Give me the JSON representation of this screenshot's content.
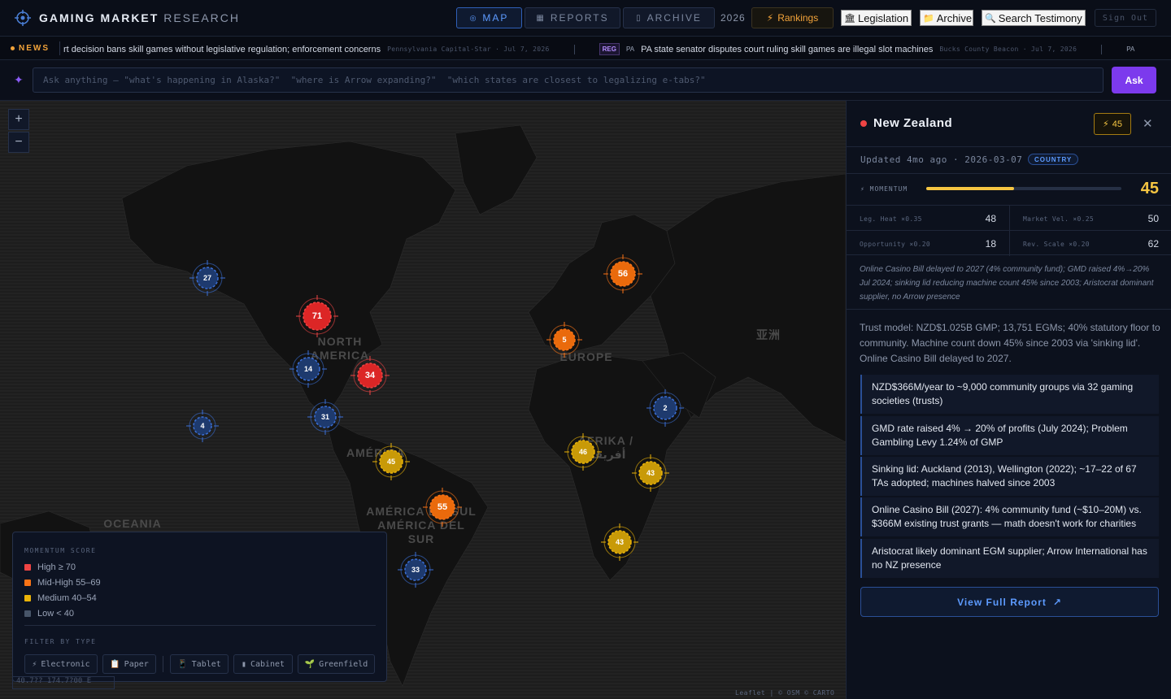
{
  "header": {
    "brand_main": "GAMING MARKET",
    "brand_sub": "RESEARCH",
    "nav": [
      {
        "icon": "◎",
        "label": "MAP"
      },
      {
        "icon": "▦",
        "label": "REPORTS"
      },
      {
        "icon": "▯",
        "label": "ARCHIVE"
      }
    ],
    "year": "2026",
    "rankings_icon": "⚡",
    "rankings_label": "Rankings",
    "legislation_icon": "🏛",
    "legislation_label": "Legislation",
    "archive_icon": "📁",
    "archive_label": "Archive",
    "testimony_icon": "🔍",
    "testimony_label": "Search Testimony",
    "signout_label": "Sign Out"
  },
  "ticker": {
    "label": "NEWS",
    "items": [
      {
        "tag": "",
        "state": "",
        "headline": "rt decision bans skill games without legislative regulation; enforcement concerns",
        "source": "Pennsylvania Capital-Star · Jul 7, 2026"
      },
      {
        "tag": "REG",
        "state": "PA",
        "headline": "PA state senator disputes court ruling skill games are illegal slot machines",
        "source": "Bucks County Beacon · Jul 7, 2026"
      },
      {
        "tag": "",
        "state": "",
        "headline": "PA",
        "source": ""
      }
    ]
  },
  "ask": {
    "icon": "✦",
    "placeholder": "Ask anything — \"what's happening in Alaska?\"  \"where is Arrow expanding?\"  \"which states are closest to legalizing e-tabs?\"",
    "button": "Ask"
  },
  "map": {
    "zoom_in": "+",
    "zoom_out": "−",
    "regions": [
      "NORTH AMERICA",
      "EUROPE",
      "AFRIKA / أفريقيا",
      "AMÉRICA DO SUL AMÉRICA DEL SUR",
      "AMÉRICA",
      "OCEANIA",
      "亚洲"
    ],
    "markers": [
      {
        "value": "27",
        "level": "low"
      },
      {
        "value": "71",
        "level": "high"
      },
      {
        "value": "14",
        "level": "low"
      },
      {
        "value": "34",
        "level": "high"
      },
      {
        "value": "31",
        "level": "low"
      },
      {
        "value": "4",
        "level": "low"
      },
      {
        "value": "45",
        "level": "medium"
      },
      {
        "value": "55",
        "level": "midhigh"
      },
      {
        "value": "33",
        "level": "low"
      },
      {
        "value": "5",
        "level": "midhigh"
      },
      {
        "value": "56",
        "level": "midhigh"
      },
      {
        "value": "2",
        "level": "low"
      },
      {
        "value": "46",
        "level": "medium"
      },
      {
        "value": "43",
        "level": "medium"
      },
      {
        "value": "43",
        "level": "medium"
      }
    ],
    "legend": {
      "title": "MOMENTUM SCORE",
      "items": [
        {
          "label": "High ≥ 70",
          "color": "#ef4444"
        },
        {
          "label": "Mid-High 55–69",
          "color": "#f97316"
        },
        {
          "label": "Medium 40–54",
          "color": "#eab308"
        },
        {
          "label": "Low < 40",
          "color": "#475569"
        }
      ],
      "filter_title": "FILTER BY TYPE",
      "filters": [
        {
          "icon": "⚡",
          "label": "Electronic"
        },
        {
          "icon": "📋",
          "label": "Paper"
        },
        {
          "icon": "📱",
          "label": "Tablet"
        },
        {
          "icon": "▮",
          "label": "Cabinet"
        },
        {
          "icon": "🌱",
          "label": "Greenfield"
        }
      ]
    },
    "coords": "40.7??  174.7?00 E",
    "attribution": "Leaflet | © OSM © CARTO"
  },
  "panel": {
    "title": "New Zealand",
    "score_icon": "⚡",
    "score": "45",
    "close": "✕",
    "updated": "Updated 4mo ago · 2026-03-07",
    "type_badge": "COUNTRY",
    "momentum_label": "⚡ MOMENTUM",
    "momentum_value": "45",
    "momentum_fraction": 0.45,
    "metrics": [
      {
        "label": "Leg. Heat ×0.35",
        "value": "48"
      },
      {
        "label": "Market Vel. ×0.25",
        "value": "50"
      },
      {
        "label": "Opportunity ×0.20",
        "value": "18"
      },
      {
        "label": "Rev. Scale ×0.20",
        "value": "62"
      }
    ],
    "summary": "Online Casino Bill delayed to 2027 (4% community fund); GMD raised 4%→20% Jul 2024; sinking lid reducing machine count 45% since 2003; Aristocrat dominant supplier, no Arrow presence",
    "description": "Trust model: NZD$1.025B GMP; 13,751 EGMs; 40% statutory floor to community. Machine count down 45% since 2003 via 'sinking lid'. Online Casino Bill delayed to 2027.",
    "facts": [
      "NZD$366M/year to ~9,000 community groups via 32 gaming societies (trusts)",
      "GMD rate raised 4% → 20% of profits (July 2024); Problem Gambling Levy 1.24% of GMP",
      "Sinking lid: Auckland (2013), Wellington (2022); ~17–22 of 67 TAs adopted; machines halved since 2003",
      "Online Casino Bill (2027): 4% community fund (~$10–20M) vs. $366M existing trust grants — math doesn't work for charities",
      "Aristocrat likely dominant EGM supplier; Arrow International has no NZ presence"
    ],
    "report_label": "View Full Report",
    "report_icon": "↗"
  }
}
